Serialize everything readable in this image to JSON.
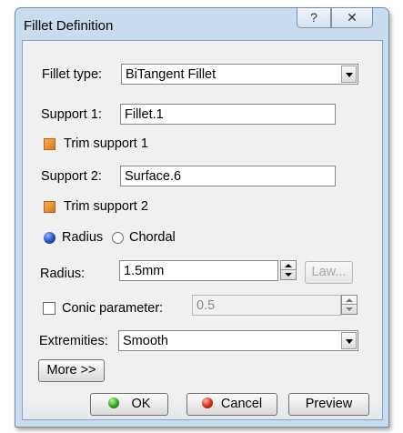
{
  "window": {
    "title": "Fillet Definition",
    "help_glyph": "?",
    "close_glyph": "✕"
  },
  "fillet_type": {
    "label": "Fillet type:",
    "value": "BiTangent Fillet"
  },
  "support1": {
    "label": "Support 1:",
    "value": "Fillet.1"
  },
  "trim1": {
    "label": "Trim support 1",
    "checked": true
  },
  "support2": {
    "label": "Support 2:",
    "value": "Surface.6"
  },
  "trim2": {
    "label": "Trim support 2",
    "checked": true
  },
  "mode": {
    "options": [
      "Radius",
      "Chordal"
    ],
    "selected": "Radius"
  },
  "radius": {
    "label": "Radius:",
    "value": "1.5mm",
    "law_button": "Law..."
  },
  "conic": {
    "label": "Conic parameter:",
    "value": "0.5",
    "checked": false
  },
  "extremities": {
    "label": "Extremities:",
    "value": "Smooth"
  },
  "more_button": "More >>",
  "buttons": {
    "ok": "OK",
    "cancel": "Cancel",
    "preview": "Preview"
  },
  "colors": {
    "accent_check": "#e8903a",
    "radio_selected": "#1f4fb8",
    "titlebar": "#c8dcee"
  }
}
